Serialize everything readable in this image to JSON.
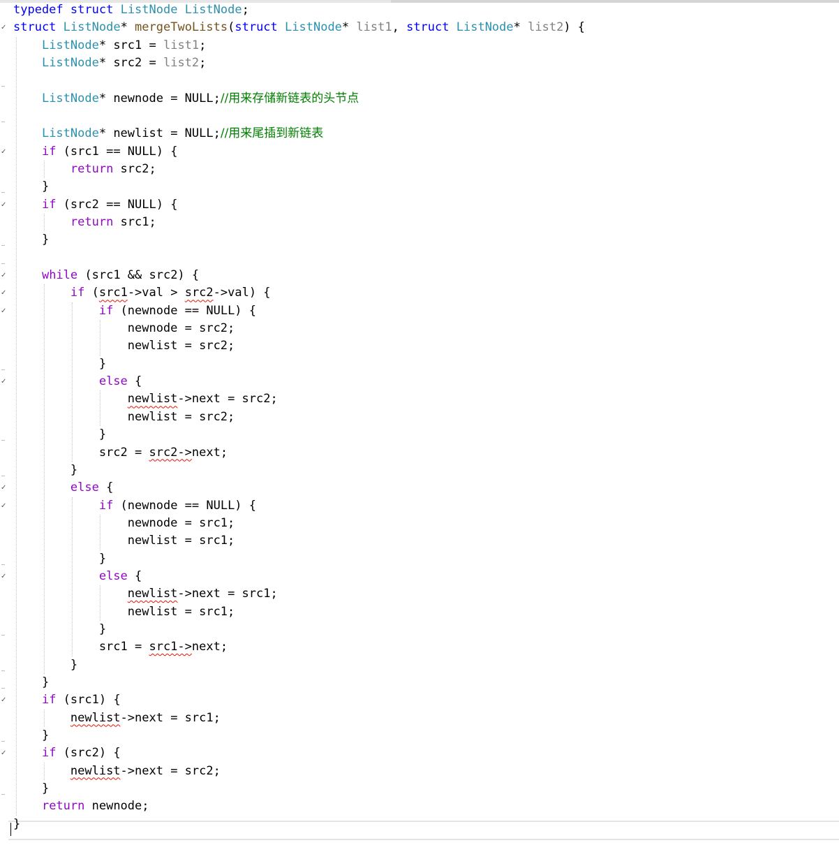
{
  "editor": {
    "language": "C",
    "lines": [
      "typedef struct ListNode ListNode;",
      "struct ListNode* mergeTwoLists(struct ListNode* list1, struct ListNode* list2) {",
      "    ListNode* src1 = list1;",
      "    ListNode* src2 = list2;",
      "",
      "    ListNode* newnode = NULL;//用来存储新链表的头节点",
      "",
      "    ListNode* newlist = NULL;//用来尾插到新链表",
      "    if (src1 == NULL) {",
      "        return src2;",
      "    }",
      "    if (src2 == NULL) {",
      "        return src1;",
      "    }",
      "",
      "    while (src1 && src2) {",
      "        if (src1->val > src2->val) {",
      "            if (newnode == NULL) {",
      "                newnode = src2;",
      "                newlist = src2;",
      "            }",
      "            else {",
      "                newlist->next = src2;",
      "                newlist = src2;",
      "            }",
      "            src2 = src2->next;",
      "        }",
      "        else {",
      "            if (newnode == NULL) {",
      "                newnode = src1;",
      "                newlist = src1;",
      "            }",
      "            else {",
      "                newlist->next = src1;",
      "                newlist = src1;",
      "            }",
      "            src1 = src1->next;",
      "        }",
      "    }",
      "    if (src1) {",
      "        newlist->next = src1;",
      "    }",
      "    if (src2) {",
      "        newlist->next = src2;",
      "    }",
      "    return newnode;",
      "}"
    ]
  },
  "colors": {
    "keyword": "#0000ff",
    "control_keyword": "#8f08c4",
    "type": "#2b91af",
    "function": "#74531f",
    "parameter": "#808080",
    "comment": "#008000",
    "squiggle": "#e51400",
    "background": "#ffffff"
  },
  "icons": {
    "fold_marker": "check-mark-icon"
  }
}
